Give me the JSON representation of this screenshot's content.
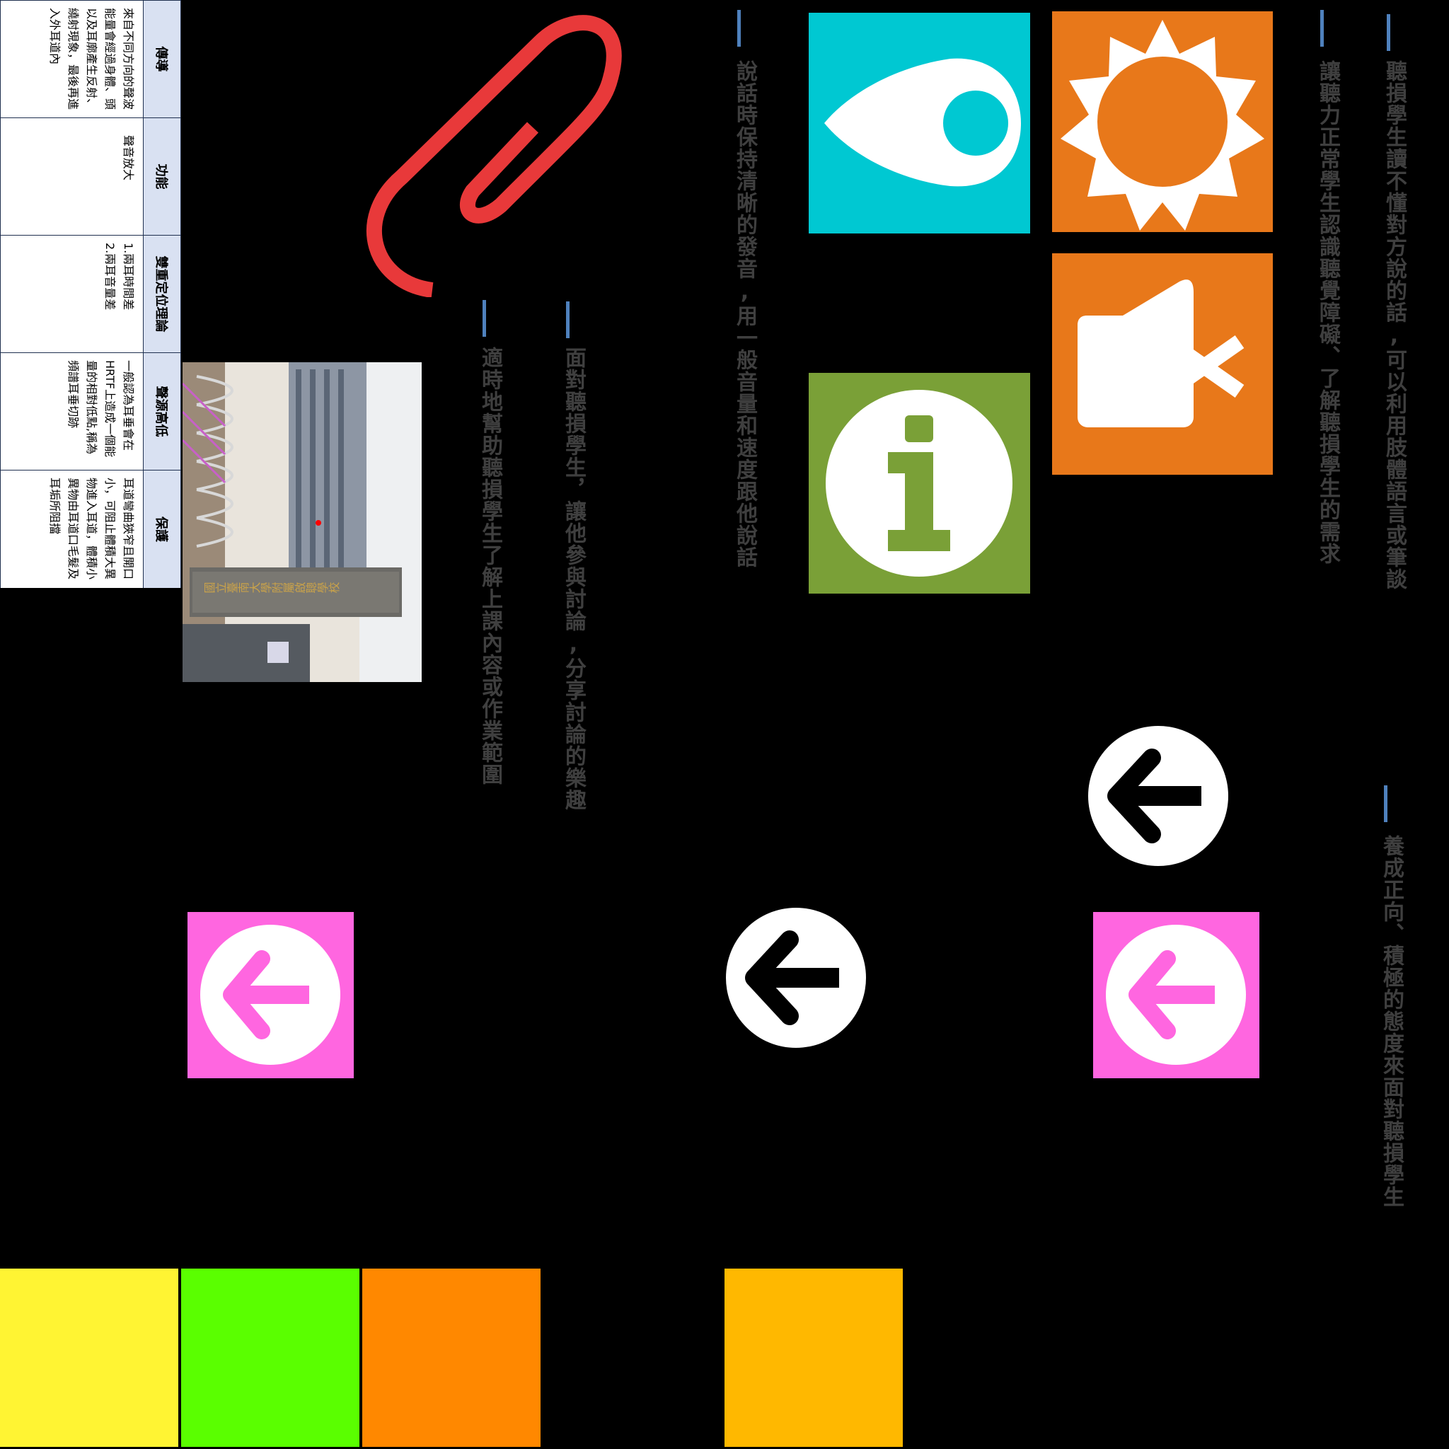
{
  "texts": {
    "t1": "聽損學生讀不懂對方說的話,可以利用肢體語言或筆談",
    "t2": "讓聽力正常學生認識聽覺障礙、了解聽損學生的需求",
    "t3": "說話時保持清晰的發音,用一般音量和速度跟他說話",
    "t4": "面對聽損學生，讓他參與討論,分享討論的樂趣",
    "t5": "適時地幫助聽損學生了解上課內容或作業範圍",
    "t6": "養成正向、積極的態度來面對聽損學生"
  },
  "table": {
    "headers": [
      "傳導",
      "功能",
      "雙重定位理論",
      "聲源高低",
      "保護"
    ],
    "cells": [
      "來自不同方向的聲波能量會經過身體、頭以及耳廓產生反射、繞射現象，最後再進入外耳道內",
      "聲音放大",
      "1.兩耳時間差\n2.兩耳音量差",
      "一般認為耳垂會在HRTF上造成一個能量的相對低點,稱為頻譜耳垂切跡",
      "耳道彎曲狹窄且開口小，可阻止體積大異物進入耳道，體積小異物由耳道口毛髮及耳垢所阻擋"
    ]
  },
  "photo": {
    "sign_text": "國立臺南大學附屬啟聰學校"
  },
  "colors": {
    "accent": "#4f81bd",
    "text_gray": "#3f3f3f",
    "clip_red": "#e8393a",
    "teal": "#00c8d2",
    "orange": "#e8781a",
    "green": "#7aa037",
    "pink": "#ff66e0",
    "yellow": "#fff433",
    "lime": "#5aff00",
    "orange2": "#ff8800",
    "amber": "#ffb800"
  },
  "icons": {
    "clip": "paperclip-icon",
    "location": "location-pin-icon",
    "sun": "sun-icon",
    "mute": "speaker-mute-icon",
    "info": "info-icon",
    "back": "back-arrow-icon"
  }
}
